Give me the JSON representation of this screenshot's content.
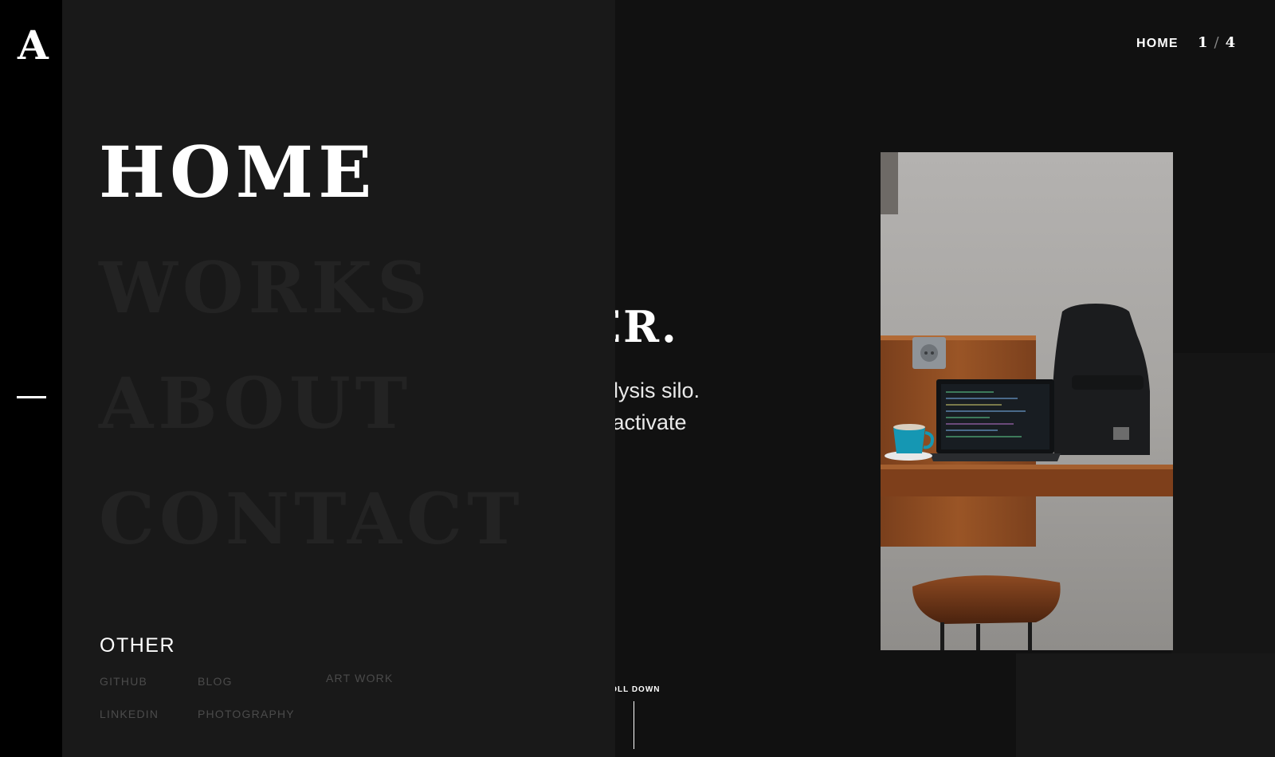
{
  "brand": {
    "logo_letter": "A"
  },
  "topbar": {
    "section": "HOME",
    "current": "1",
    "separator": "/",
    "total": "4"
  },
  "hero": {
    "title_fragment": "ER.",
    "text_line1": "nalysis silo.",
    "text_line2": "ct activate"
  },
  "scroll": {
    "label": "ROLL DOWN"
  },
  "menu": {
    "items": [
      {
        "label": "HOME"
      },
      {
        "label": "WORKS"
      },
      {
        "label": "ABOUT"
      },
      {
        "label": "CONTACT"
      }
    ],
    "active_index": 0
  },
  "other": {
    "title": "OTHER",
    "links": [
      "GITHUB",
      "BLOG",
      "ART WORK",
      "LINKEDIN",
      "PHOTOGRAPHY"
    ]
  },
  "colors": {
    "sidebar": "#000000",
    "menu_panel": "#191919",
    "page": "#111111",
    "menu_dim": "#232323",
    "link_dim": "#4b4b4b"
  }
}
